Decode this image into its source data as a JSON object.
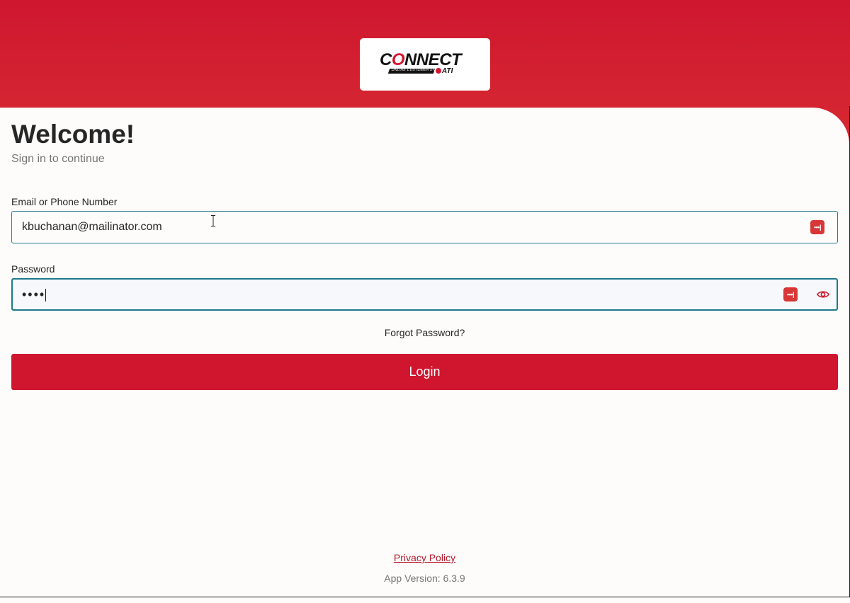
{
  "brand": {
    "logo_word_pre": "C",
    "logo_word_o": "O",
    "logo_word_post": "NNECT",
    "logo_tagline": "ONLINE CUSTOMER ENGAGEMENT",
    "logo_ati": "ATI",
    "primary_color": "#d0152f",
    "focus_color": "#1e7a8b"
  },
  "welcome": {
    "title": "Welcome!",
    "subtitle": "Sign in to continue"
  },
  "form": {
    "email_label": "Email or Phone Number",
    "email_value": "kbuchanan@mailinator.com",
    "password_label": "Password",
    "password_value": "••••",
    "autofill_icon_glyph": "•••|",
    "forgot_password": "Forgot Password?",
    "login_button": "Login"
  },
  "footer": {
    "privacy_policy": "Privacy Policy",
    "app_version": "App Version: 6.3.9"
  }
}
